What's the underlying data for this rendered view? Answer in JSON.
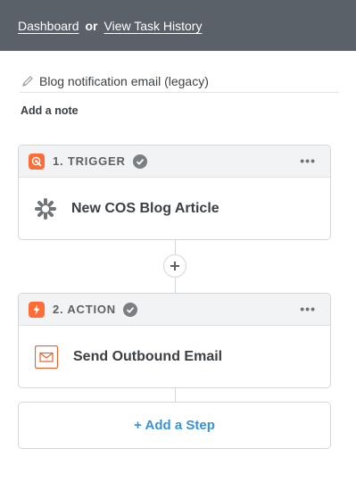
{
  "header": {
    "dashboard_link": "Dashboard",
    "separator": "or",
    "history_link": "View Task History"
  },
  "zap": {
    "name": "Blog notification email (legacy)",
    "add_note": "Add a note"
  },
  "steps": [
    {
      "label": "1. TRIGGER",
      "app_title": "New COS Blog Article",
      "more": "•••",
      "icon": "trigger-icon",
      "app_icon": "hubspot-sprocket-icon"
    },
    {
      "label": "2. ACTION",
      "app_title": "Send Outbound Email",
      "more": "•••",
      "icon": "lightning-icon",
      "app_icon": "envelope-icon"
    }
  ],
  "add_step": {
    "label": "+ Add a Step"
  },
  "colors": {
    "header_bg": "#5b6168",
    "accent_orange": "#ff6c37",
    "link_blue": "#3a92d6",
    "check_gray": "#7a7f84"
  }
}
